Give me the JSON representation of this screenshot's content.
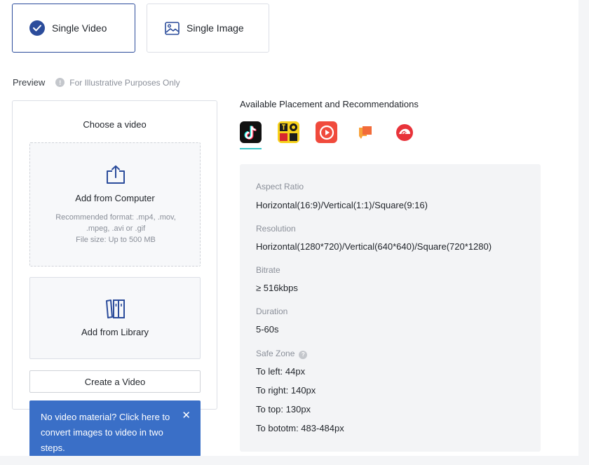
{
  "creative_types": {
    "video_label": "Single Video",
    "image_label": "Single Image"
  },
  "preview": {
    "label": "Preview",
    "note": "For Illustrative Purposes Only"
  },
  "chooser": {
    "title": "Choose a video",
    "computer": {
      "title": "Add from Computer",
      "hint": "Recommended format: .mp4, .mov, .mpeg, .avi or .gif",
      "size_hint": "File size: Up to 500 MB"
    },
    "library": {
      "title": "Add from Library"
    },
    "create_button": "Create a Video"
  },
  "tooltip": {
    "text": "No video material? Click here to convert images to video in two steps.",
    "close": "✕"
  },
  "placements": {
    "title": "Available Placement and Recommendations",
    "apps": [
      "tiktok-icon",
      "topbuzz-icon",
      "buzzvideo-icon",
      "news-app-icon",
      "pangle-icon"
    ],
    "accent": "#37c6c7"
  },
  "specs": {
    "aspect_label": "Aspect Ratio",
    "aspect_value": "Horizontal(16:9)/Vertical(1:1)/Square(9:16)",
    "resolution_label": "Resolution",
    "resolution_value": "Horizontal(1280*720)/Vertical(640*640)/Square(720*1280)",
    "bitrate_label": "Bitrate",
    "bitrate_value": "≥ 516kbps",
    "duration_label": "Duration",
    "duration_value": "5-60s",
    "safezone_label": "Safe Zone",
    "to_left": "To left: 44px",
    "to_right": "To right: 140px",
    "to_top": "To top: 130px",
    "to_bottom": "To bototm: 483-484px"
  },
  "colors": {
    "primary": "#2b4c9b",
    "tooltip_bg": "#3a6fc7"
  }
}
